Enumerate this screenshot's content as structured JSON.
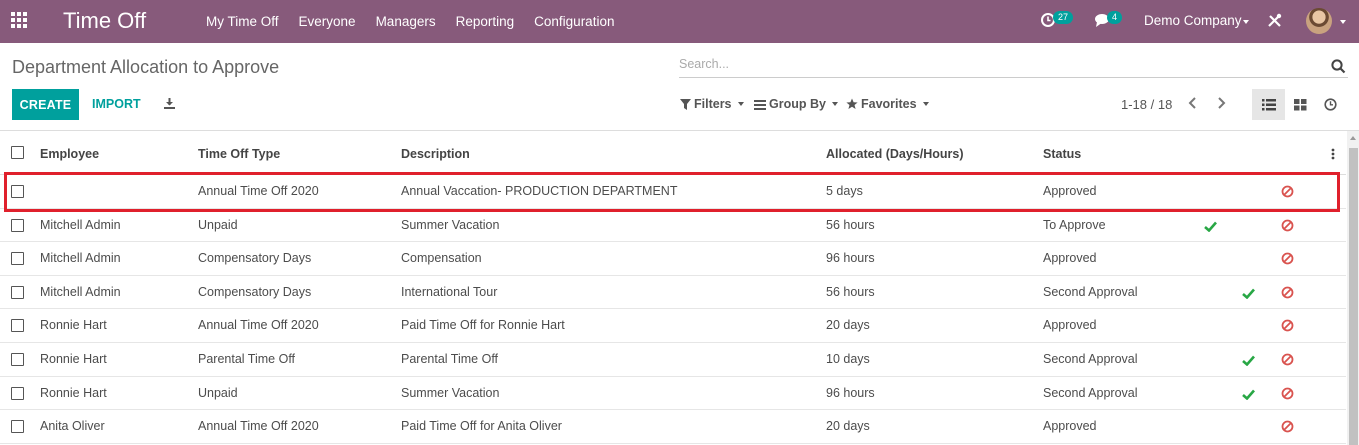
{
  "navbar": {
    "app_title": "Time Off",
    "menu": [
      "My Time Off",
      "Everyone",
      "Managers",
      "Reporting",
      "Configuration"
    ],
    "activity_count": "27",
    "message_count": "4",
    "company": "Demo Company",
    "brand_color": "#875a7b",
    "icons": [
      "apps-grid-icon",
      "clock-activity-icon",
      "chat-icon",
      "tools-icon",
      "avatar"
    ]
  },
  "control_panel": {
    "breadcrumb": "Department Allocation to Approve",
    "search_placeholder": "Search...",
    "create_label": "CREATE",
    "import_label": "IMPORT",
    "filters_label": "Filters",
    "groupby_label": "Group By",
    "favorites_label": "Favorites",
    "pager": "1-18 / 18",
    "accent_color": "#00a09d"
  },
  "table": {
    "columns": [
      "Employee",
      "Time Off Type",
      "Description",
      "Allocated (Days/Hours)",
      "Status"
    ],
    "rows": [
      {
        "employee": "",
        "type": "Annual Time Off 2020",
        "description": "Annual Vaccation- PRODUCTION DEPARTMENT",
        "allocated": "5 days",
        "status": "Approved",
        "approve": "none"
      },
      {
        "employee": "Mitchell Admin",
        "type": "Unpaid",
        "description": "Summer Vacation",
        "allocated": "56 hours",
        "status": "To Approve",
        "approve": "first"
      },
      {
        "employee": "Mitchell Admin",
        "type": "Compensatory Days",
        "description": "Compensation",
        "allocated": "96 hours",
        "status": "Approved",
        "approve": "none"
      },
      {
        "employee": "Mitchell Admin",
        "type": "Compensatory Days",
        "description": "International Tour",
        "allocated": "56 hours",
        "status": "Second Approval",
        "approve": "second"
      },
      {
        "employee": "Ronnie Hart",
        "type": "Annual Time Off 2020",
        "description": "Paid Time Off for Ronnie Hart",
        "allocated": "20 days",
        "status": "Approved",
        "approve": "none"
      },
      {
        "employee": "Ronnie Hart",
        "type": "Parental Time Off",
        "description": "Parental Time Off",
        "allocated": "10 days",
        "status": "Second Approval",
        "approve": "second"
      },
      {
        "employee": "Ronnie Hart",
        "type": "Unpaid",
        "description": "Summer Vacation",
        "allocated": "96 hours",
        "status": "Second Approval",
        "approve": "second"
      },
      {
        "employee": "Anita Oliver",
        "type": "Annual Time Off 2020",
        "description": "Paid Time Off for Anita Oliver",
        "allocated": "20 days",
        "status": "Approved",
        "approve": "none"
      }
    ],
    "highlighted_row": 0,
    "highlight_color": "#e0202c",
    "approve_color": "#28a745",
    "refuse_color": "#d9534f"
  }
}
